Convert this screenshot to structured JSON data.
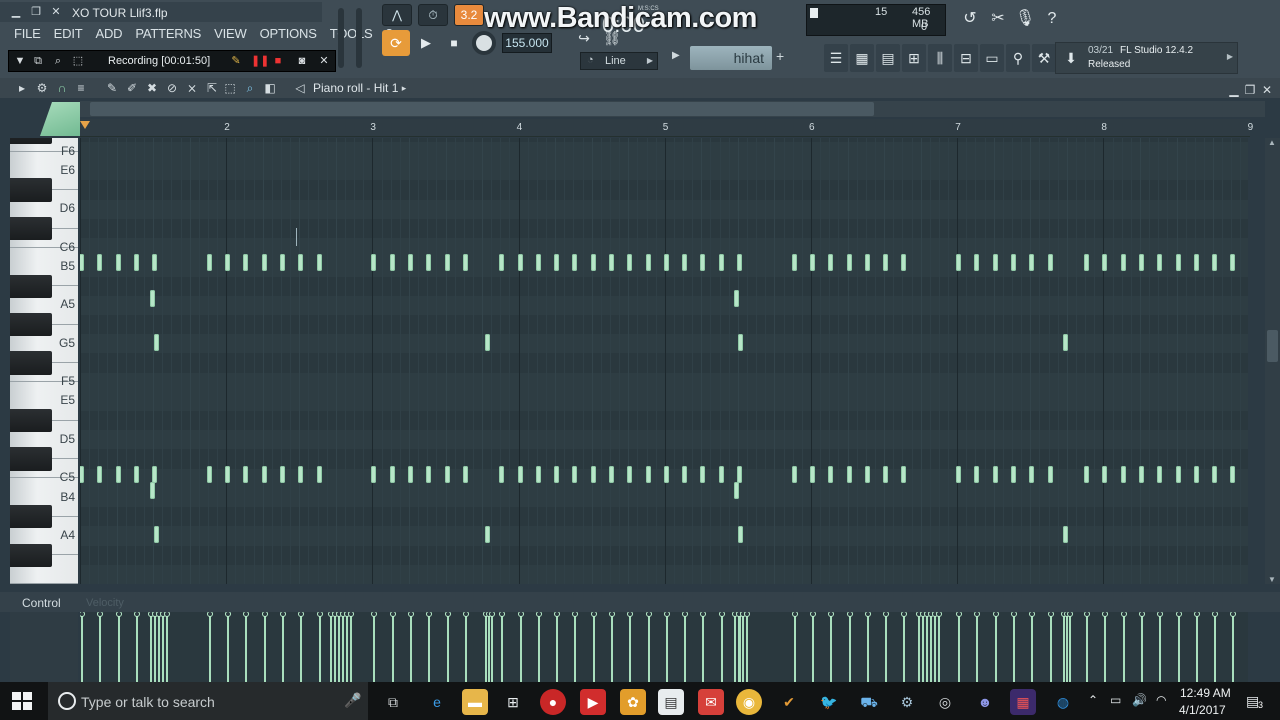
{
  "window": {
    "file_title": "XO TOUR Llif3.flp"
  },
  "menu": [
    "FILE",
    "EDIT",
    "ADD",
    "PATTERNS",
    "VIEW",
    "OPTIONS",
    "TOOLS",
    "?"
  ],
  "recording": {
    "text": "Recording [00:01:50]"
  },
  "transport": {
    "tempo": "155.000",
    "time_label": "M:S:CS",
    "time_value": "0:00",
    "pat_song_label": "3.2"
  },
  "watermark": "www.Bandicam.com",
  "snap": {
    "label": "Line"
  },
  "pattern": {
    "name": "hihat",
    "add": "+"
  },
  "monitor": {
    "cpu": "15",
    "memory": "456 MB",
    "polyphony": "0"
  },
  "news": {
    "date": "03/21",
    "title": "FL Studio 12.4.2",
    "status": "Released"
  },
  "piano_roll": {
    "title": "Piano roll - Hit 1",
    "bars": [
      "2",
      "3",
      "4",
      "5",
      "6",
      "7",
      "8",
      "9"
    ],
    "key_labels": [
      "F6",
      "E6",
      "D6",
      "C6",
      "B5",
      "A5",
      "G5",
      "F5",
      "E5",
      "D5",
      "C5",
      "B4",
      "A4"
    ],
    "control_label": "Control",
    "control_target": "Velocity",
    "accent_color": "#b7e6c8"
  },
  "taskbar": {
    "search_placeholder": "Type or talk to search",
    "time": "12:49 AM",
    "date": "4/1/2017",
    "notification_count": "3"
  }
}
